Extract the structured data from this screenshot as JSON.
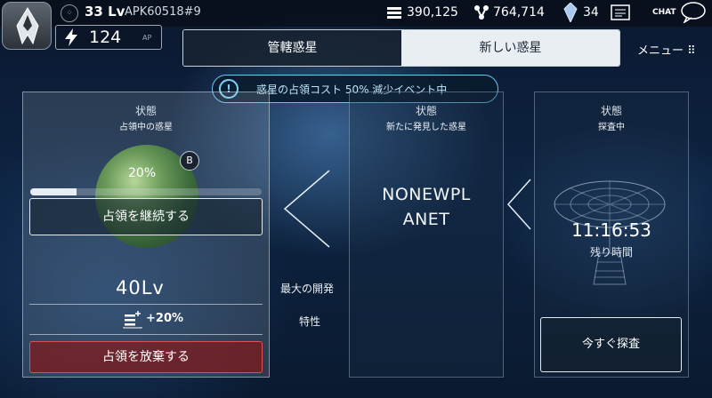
{
  "header": {
    "level": "33 Lv",
    "player_id": "APK60518#9",
    "resource_1": "390,125",
    "resource_2": "764,714",
    "crystals": "34",
    "chat_label": "CHAT",
    "ap_value": "124",
    "ap_unit": "AP",
    "level_icon": "grid-dots-icon",
    "resource_1_icon": "stack-icon",
    "resource_2_icon": "molecule-icon",
    "crystal_icon": "crystal-icon",
    "mail_icon": "message-board-icon",
    "ap_icon": "lightning-icon"
  },
  "tabs": [
    {
      "label": "管轄惑星",
      "active": false
    },
    {
      "label": "新しい惑星",
      "active": true
    }
  ],
  "menu_label": "メニュー",
  "event_banner": "惑星の占領コスト 50% 減少イベント中",
  "left_panel": {
    "status_label": "状態",
    "status_value": "占領中の惑星",
    "planet_grade": "B",
    "progress_label": "20%",
    "progress": 0.2,
    "continue_button": "占領を継続する",
    "level": "40Lv",
    "bonus": "+20%",
    "abandon_button": "占領を放棄する"
  },
  "middle_labels": {
    "max_dev": "最大の開発",
    "trait": "特性"
  },
  "center_panel": {
    "status_label": "状態",
    "status_value": "新たに発見した惑星",
    "planet_name_line1": "NONEWPL",
    "planet_name_line2": "ANET"
  },
  "right_panel": {
    "status_label": "状態",
    "status_value": "探査中",
    "timer": "11:16:53",
    "remaining_label": "残り時間",
    "explore_button": "今すぐ探査"
  },
  "colors": {
    "accent_cyan": "#6fc3ee",
    "danger_red": "#e05050",
    "tab_active_bg": "#e9eef2"
  }
}
